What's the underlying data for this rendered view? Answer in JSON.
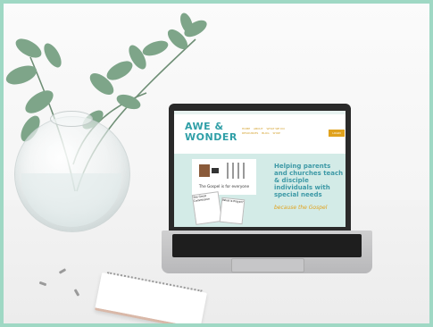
{
  "website": {
    "logo_line1": "AWE &",
    "logo_line2": "WONDER",
    "nav": [
      "HOME",
      "ABOUT",
      "WHAT WE DO",
      "RESOURCES",
      "BLOG",
      "SHOP"
    ],
    "login_label": "LOGIN",
    "card_caption": "The Gospel is for everyone",
    "card_small_title": "The Great Commission",
    "card_small2_title": "What is Prayer?",
    "headline": "Helping parents and churches teach & disciple individuals with special needs",
    "script_text": "because the Gospel"
  },
  "colors": {
    "teal": "#3d99a6",
    "gold": "#e0a21d",
    "mint_border": "#9fd8c4"
  }
}
